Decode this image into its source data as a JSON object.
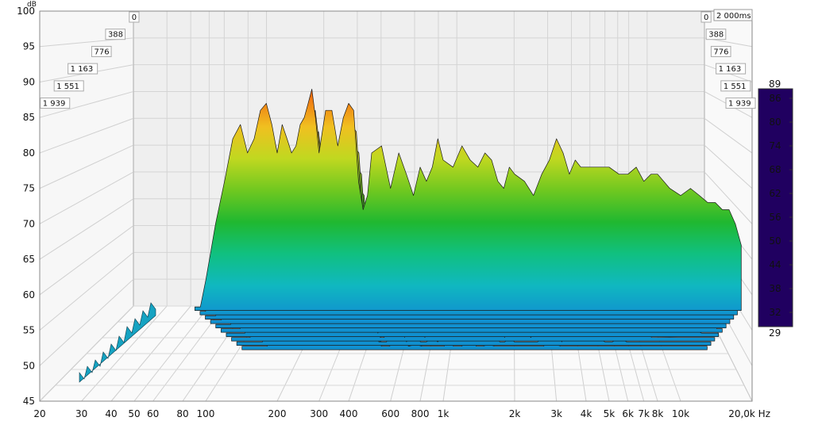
{
  "chart_data": {
    "type": "waterfall-3d",
    "y_unit": "dB",
    "x_unit": "Hz",
    "y_range": [
      45,
      100
    ],
    "y_ticks": [
      "100",
      "95",
      "90",
      "85",
      "80",
      "75",
      "70",
      "65",
      "60",
      "55",
      "50",
      "45"
    ],
    "x_range_hz": [
      20,
      20000
    ],
    "x_scale": "log",
    "x_ticks": [
      {
        "hz": 20,
        "label": "20"
      },
      {
        "hz": 30,
        "label": "30"
      },
      {
        "hz": 40,
        "label": "40"
      },
      {
        "hz": 50,
        "label": "50"
      },
      {
        "hz": 60,
        "label": "60"
      },
      {
        "hz": 80,
        "label": "80"
      },
      {
        "hz": 100,
        "label": "100"
      },
      {
        "hz": 200,
        "label": "200"
      },
      {
        "hz": 300,
        "label": "300"
      },
      {
        "hz": 400,
        "label": "400"
      },
      {
        "hz": 600,
        "label": "600"
      },
      {
        "hz": 800,
        "label": "800"
      },
      {
        "hz": 1000,
        "label": "1k"
      },
      {
        "hz": 2000,
        "label": "2k"
      },
      {
        "hz": 3000,
        "label": "3k"
      },
      {
        "hz": 4000,
        "label": "4k"
      },
      {
        "hz": 5000,
        "label": "5k"
      },
      {
        "hz": 6000,
        "label": "6k"
      },
      {
        "hz": 7000,
        "label": "7k"
      },
      {
        "hz": 8000,
        "label": "8k"
      },
      {
        "hz": 10000,
        "label": "10k"
      },
      {
        "hz": 20000,
        "label": "20,0k Hz"
      }
    ],
    "time_labels_left": [
      "0",
      "388",
      "776",
      "1 163",
      "1 551",
      "1 939"
    ],
    "time_labels_right": [
      "0",
      "388",
      "776",
      "1 163",
      "1 551",
      "1 939"
    ],
    "time_max_label": "2 000ms",
    "time_ms": [
      0,
      388,
      776,
      1163,
      1551,
      1939
    ],
    "colorbar": {
      "max_label": "89",
      "min_label": "29",
      "ticks": [
        "86",
        "80",
        "74",
        "68",
        "62",
        "56",
        "50",
        "44",
        "38",
        "32"
      ],
      "stops": [
        "#200060",
        "#3010b0",
        "#1060e0",
        "#10b0e0",
        "#10d0a0",
        "#20c040",
        "#80d020",
        "#f0e020",
        "#f08010",
        "#e01010"
      ]
    },
    "front_slice": {
      "freq_hz": [
        90,
        95,
        100,
        105,
        110,
        120,
        130,
        140,
        150,
        160,
        170,
        180,
        190,
        200,
        210,
        220,
        230,
        240,
        250,
        260,
        270,
        280,
        290,
        300,
        320,
        340,
        360,
        380,
        400,
        420,
        440,
        460,
        480,
        500,
        550,
        600,
        650,
        700,
        750,
        800,
        850,
        900,
        950,
        1000,
        1100,
        1200,
        1300,
        1400,
        1500,
        1600,
        1700,
        1800,
        1900,
        2000,
        2200,
        2400,
        2600,
        2800,
        3000,
        3200,
        3400,
        3600,
        3800,
        4000,
        4500,
        5000,
        5500,
        6000,
        6500,
        7000,
        7500,
        8000,
        9000,
        10000,
        11000,
        12000,
        13000,
        14000,
        15000,
        16000,
        17000,
        18000
      ],
      "db": [
        57,
        58,
        62,
        66,
        70,
        76,
        82,
        84,
        80,
        82,
        86,
        87,
        84,
        80,
        84,
        82,
        80,
        81,
        84,
        85,
        87,
        89,
        85,
        80,
        86,
        86,
        81,
        85,
        87,
        86,
        76,
        72,
        74,
        80,
        81,
        75,
        80,
        77,
        74,
        78,
        76,
        78,
        82,
        79,
        78,
        81,
        79,
        78,
        80,
        79,
        76,
        75,
        78,
        77,
        76,
        74,
        77,
        79,
        82,
        80,
        77,
        79,
        78,
        78,
        78,
        78,
        77,
        77,
        78,
        76,
        77,
        77,
        75,
        74,
        75,
        74,
        73,
        73,
        72,
        72,
        70,
        67
      ]
    },
    "slices_db_drop": [
      0,
      3,
      6,
      9,
      12,
      15,
      18,
      21,
      24,
      27
    ]
  }
}
